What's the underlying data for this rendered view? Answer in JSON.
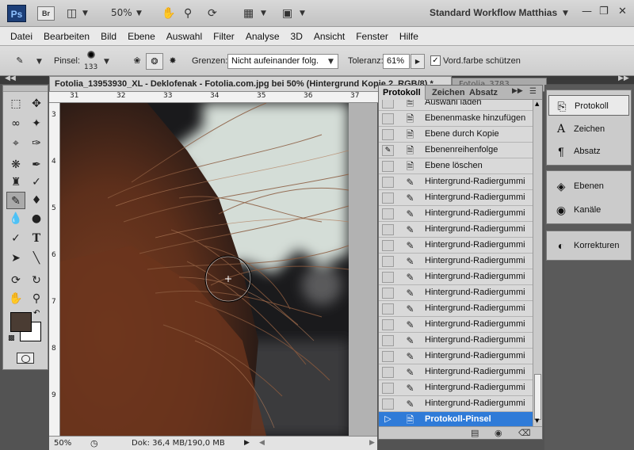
{
  "app": {
    "logo": "Ps",
    "bridge": "Br",
    "zoom_select": "50%",
    "workspace": "Standard Workflow Matthias"
  },
  "menu": [
    "Datei",
    "Bearbeiten",
    "Bild",
    "Ebene",
    "Auswahl",
    "Filter",
    "Analyse",
    "3D",
    "Ansicht",
    "Fenster",
    "Hilfe"
  ],
  "options": {
    "brush_label": "Pinsel:",
    "brush_size": "133",
    "limits_label": "Grenzen:",
    "limits_value": "Nicht aufeinander folg.",
    "tolerance_label": "Toleranz:",
    "tolerance_value": "61%",
    "protect_label": "Vord.farbe schützen"
  },
  "document": {
    "title": "Fotolia_13953930_XL - Deklofenak - Fotolia.com.jpg bei 50% (Hintergrund Kopie 2, RGB/8) *",
    "second_tab": "Fotolia_3783",
    "ruler_h": [
      "31",
      "32",
      "33",
      "34",
      "35",
      "36",
      "37"
    ],
    "ruler_v": [
      "3",
      "4",
      "5",
      "6",
      "7",
      "8",
      "9"
    ],
    "status_zoom": "50%",
    "status_doc": "Dok: 36,4 MB/190,0 MB"
  },
  "colors": {
    "foreground": "#4a3c33",
    "background": "#ffffff",
    "selection": "#2f7bd8"
  },
  "panel": {
    "tabs": [
      "Protokoll",
      "Zeichen",
      "Absatz"
    ],
    "history": [
      {
        "label": "Auswahl laden",
        "icon": "doc-icon"
      },
      {
        "label": "Ebenenmaske hinzufügen",
        "icon": "doc-icon"
      },
      {
        "label": "Ebene durch Kopie",
        "icon": "doc-icon"
      },
      {
        "label": "Ebenenreihenfolge",
        "icon": "doc-icon",
        "source": true
      },
      {
        "label": "Ebene löschen",
        "icon": "doc-icon"
      },
      {
        "label": "Hintergrund-Radiergummi",
        "icon": "eraser-icon"
      },
      {
        "label": "Hintergrund-Radiergummi",
        "icon": "eraser-icon"
      },
      {
        "label": "Hintergrund-Radiergummi",
        "icon": "eraser-icon"
      },
      {
        "label": "Hintergrund-Radiergummi",
        "icon": "eraser-icon"
      },
      {
        "label": "Hintergrund-Radiergummi",
        "icon": "eraser-icon"
      },
      {
        "label": "Hintergrund-Radiergummi",
        "icon": "eraser-icon"
      },
      {
        "label": "Hintergrund-Radiergummi",
        "icon": "eraser-icon"
      },
      {
        "label": "Hintergrund-Radiergummi",
        "icon": "eraser-icon"
      },
      {
        "label": "Hintergrund-Radiergummi",
        "icon": "eraser-icon"
      },
      {
        "label": "Hintergrund-Radiergummi",
        "icon": "eraser-icon"
      },
      {
        "label": "Hintergrund-Radiergummi",
        "icon": "eraser-icon"
      },
      {
        "label": "Hintergrund-Radiergummi",
        "icon": "eraser-icon"
      },
      {
        "label": "Hintergrund-Radiergummi",
        "icon": "eraser-icon"
      },
      {
        "label": "Hintergrund-Radiergummi",
        "icon": "eraser-icon"
      },
      {
        "label": "Hintergrund-Radiergummi",
        "icon": "eraser-icon"
      },
      {
        "label": "Protokoll-Pinsel",
        "icon": "doc-icon",
        "active": true
      }
    ]
  },
  "dock": [
    {
      "label": "Protokoll",
      "icon": "history-icon",
      "active": true
    },
    {
      "label": "Zeichen",
      "icon": "character-icon"
    },
    {
      "label": "Absatz",
      "icon": "paragraph-icon"
    },
    {
      "label": "Ebenen",
      "icon": "layers-icon"
    },
    {
      "label": "Kanäle",
      "icon": "channels-icon"
    },
    {
      "label": "Korrekturen",
      "icon": "adjustments-icon"
    }
  ]
}
